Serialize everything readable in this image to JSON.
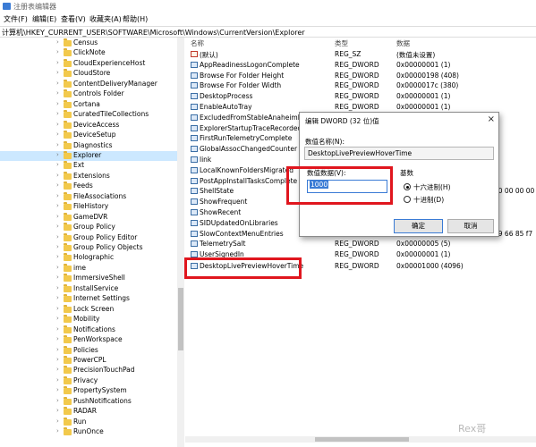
{
  "window": {
    "title": "注册表编辑器"
  },
  "menu": [
    "文件(F)",
    "编辑(E)",
    "查看(V)",
    "收藏夹(A)",
    "帮助(H)"
  ],
  "address": "计算机\\HKEY_CURRENT_USER\\SOFTWARE\\Microsoft\\Windows\\CurrentVersion\\Explorer",
  "tree": [
    {
      "label": "Census"
    },
    {
      "label": "ClickNote"
    },
    {
      "label": "CloudExperienceHost"
    },
    {
      "label": "CloudStore"
    },
    {
      "label": "ContentDeliveryManager"
    },
    {
      "label": "Controls Folder"
    },
    {
      "label": "Cortana"
    },
    {
      "label": "CuratedTileCollections"
    },
    {
      "label": "DeviceAccess"
    },
    {
      "label": "DeviceSetup"
    },
    {
      "label": "Diagnostics"
    },
    {
      "label": "Explorer",
      "selected": true
    },
    {
      "label": "Ext"
    },
    {
      "label": "Extensions"
    },
    {
      "label": "Feeds"
    },
    {
      "label": "FileAssociations"
    },
    {
      "label": "FileHistory"
    },
    {
      "label": "GameDVR"
    },
    {
      "label": "Group Policy"
    },
    {
      "label": "Group Policy Editor"
    },
    {
      "label": "Group Policy Objects"
    },
    {
      "label": "Holographic"
    },
    {
      "label": "ime"
    },
    {
      "label": "ImmersiveShell"
    },
    {
      "label": "InstallService"
    },
    {
      "label": "Internet Settings"
    },
    {
      "label": "Lock Screen"
    },
    {
      "label": "Mobility"
    },
    {
      "label": "Notifications"
    },
    {
      "label": "PenWorkspace"
    },
    {
      "label": "Policies"
    },
    {
      "label": "PowerCPL"
    },
    {
      "label": "PrecisionTouchPad"
    },
    {
      "label": "Privacy"
    },
    {
      "label": "PropertySystem"
    },
    {
      "label": "PushNotifications"
    },
    {
      "label": "RADAR"
    },
    {
      "label": "Run"
    },
    {
      "label": "RunOnce"
    }
  ],
  "columns": {
    "name": "名称",
    "type": "类型",
    "data": "数据"
  },
  "values": [
    {
      "name": "(默认)",
      "type": "REG_SZ",
      "data": "(数值未设置)",
      "icon": "string"
    },
    {
      "name": "AppReadinessLogonComplete",
      "type": "REG_DWORD",
      "data": "0x00000001 (1)",
      "icon": "dword"
    },
    {
      "name": "Browse For Folder Height",
      "type": "REG_DWORD",
      "data": "0x00000198 (408)",
      "icon": "dword"
    },
    {
      "name": "Browse For Folder Width",
      "type": "REG_DWORD",
      "data": "0x0000017c (380)",
      "icon": "dword"
    },
    {
      "name": "DesktopProcess",
      "type": "REG_DWORD",
      "data": "0x00000001 (1)",
      "icon": "dword"
    },
    {
      "name": "EnableAutoTray",
      "type": "REG_DWORD",
      "data": "0x00000001 (1)",
      "icon": "dword"
    },
    {
      "name": "ExcludedFromStableAnaheimDown",
      "type": "",
      "data": "",
      "icon": "dword"
    },
    {
      "name": "ExplorerStartupTraceRecorded",
      "type": "",
      "data": "",
      "icon": "dword"
    },
    {
      "name": "FirstRunTelemetryComplete",
      "type": "",
      "data": "",
      "icon": "dword"
    },
    {
      "name": "GlobalAssocChangedCounter",
      "type": "",
      "data": "",
      "icon": "dword"
    },
    {
      "name": "link",
      "type": "",
      "data": "",
      "icon": "dword"
    },
    {
      "name": "LocalKnownFoldersMigrated",
      "type": "",
      "data": "",
      "icon": "dword"
    },
    {
      "name": "PostAppInstallTasksComplete",
      "type": "",
      "data": "",
      "icon": "dword"
    },
    {
      "name": "ShellState",
      "type": "",
      "data": "00 00 00 00",
      "icon": "dword"
    },
    {
      "name": "ShowFrequent",
      "type": "",
      "data": "",
      "icon": "dword"
    },
    {
      "name": "ShowRecent",
      "type": "",
      "data": "",
      "icon": "dword"
    },
    {
      "name": "SIDUpdatedOnLibraries",
      "type": "",
      "data": "",
      "icon": "dword"
    },
    {
      "name": "SlowContextMenuEntries",
      "type": "",
      "data": "69 66 85 f7",
      "icon": "dword"
    },
    {
      "name": "TelemetrySalt",
      "type": "REG_DWORD",
      "data": "0x00000005 (5)",
      "icon": "dword"
    },
    {
      "name": "UserSignedIn",
      "type": "REG_DWORD",
      "data": "0x00000001 (1)",
      "icon": "dword"
    },
    {
      "name": "DesktopLivePreviewHoverTime",
      "type": "REG_DWORD",
      "data": "0x00001000 (4096)",
      "icon": "dword"
    }
  ],
  "dialog": {
    "title": "编辑 DWORD (32 位)值",
    "close": "×",
    "name_label": "数值名称(N):",
    "name_value": "DesktopLivePreviewHoverTime",
    "data_label": "数值数据(V):",
    "data_value": "1000",
    "base_label": "基数",
    "base_hex": "十六进制(H)",
    "base_dec": "十进制(D)",
    "ok": "确定",
    "cancel": "取消"
  },
  "watermark": "Rex哥"
}
